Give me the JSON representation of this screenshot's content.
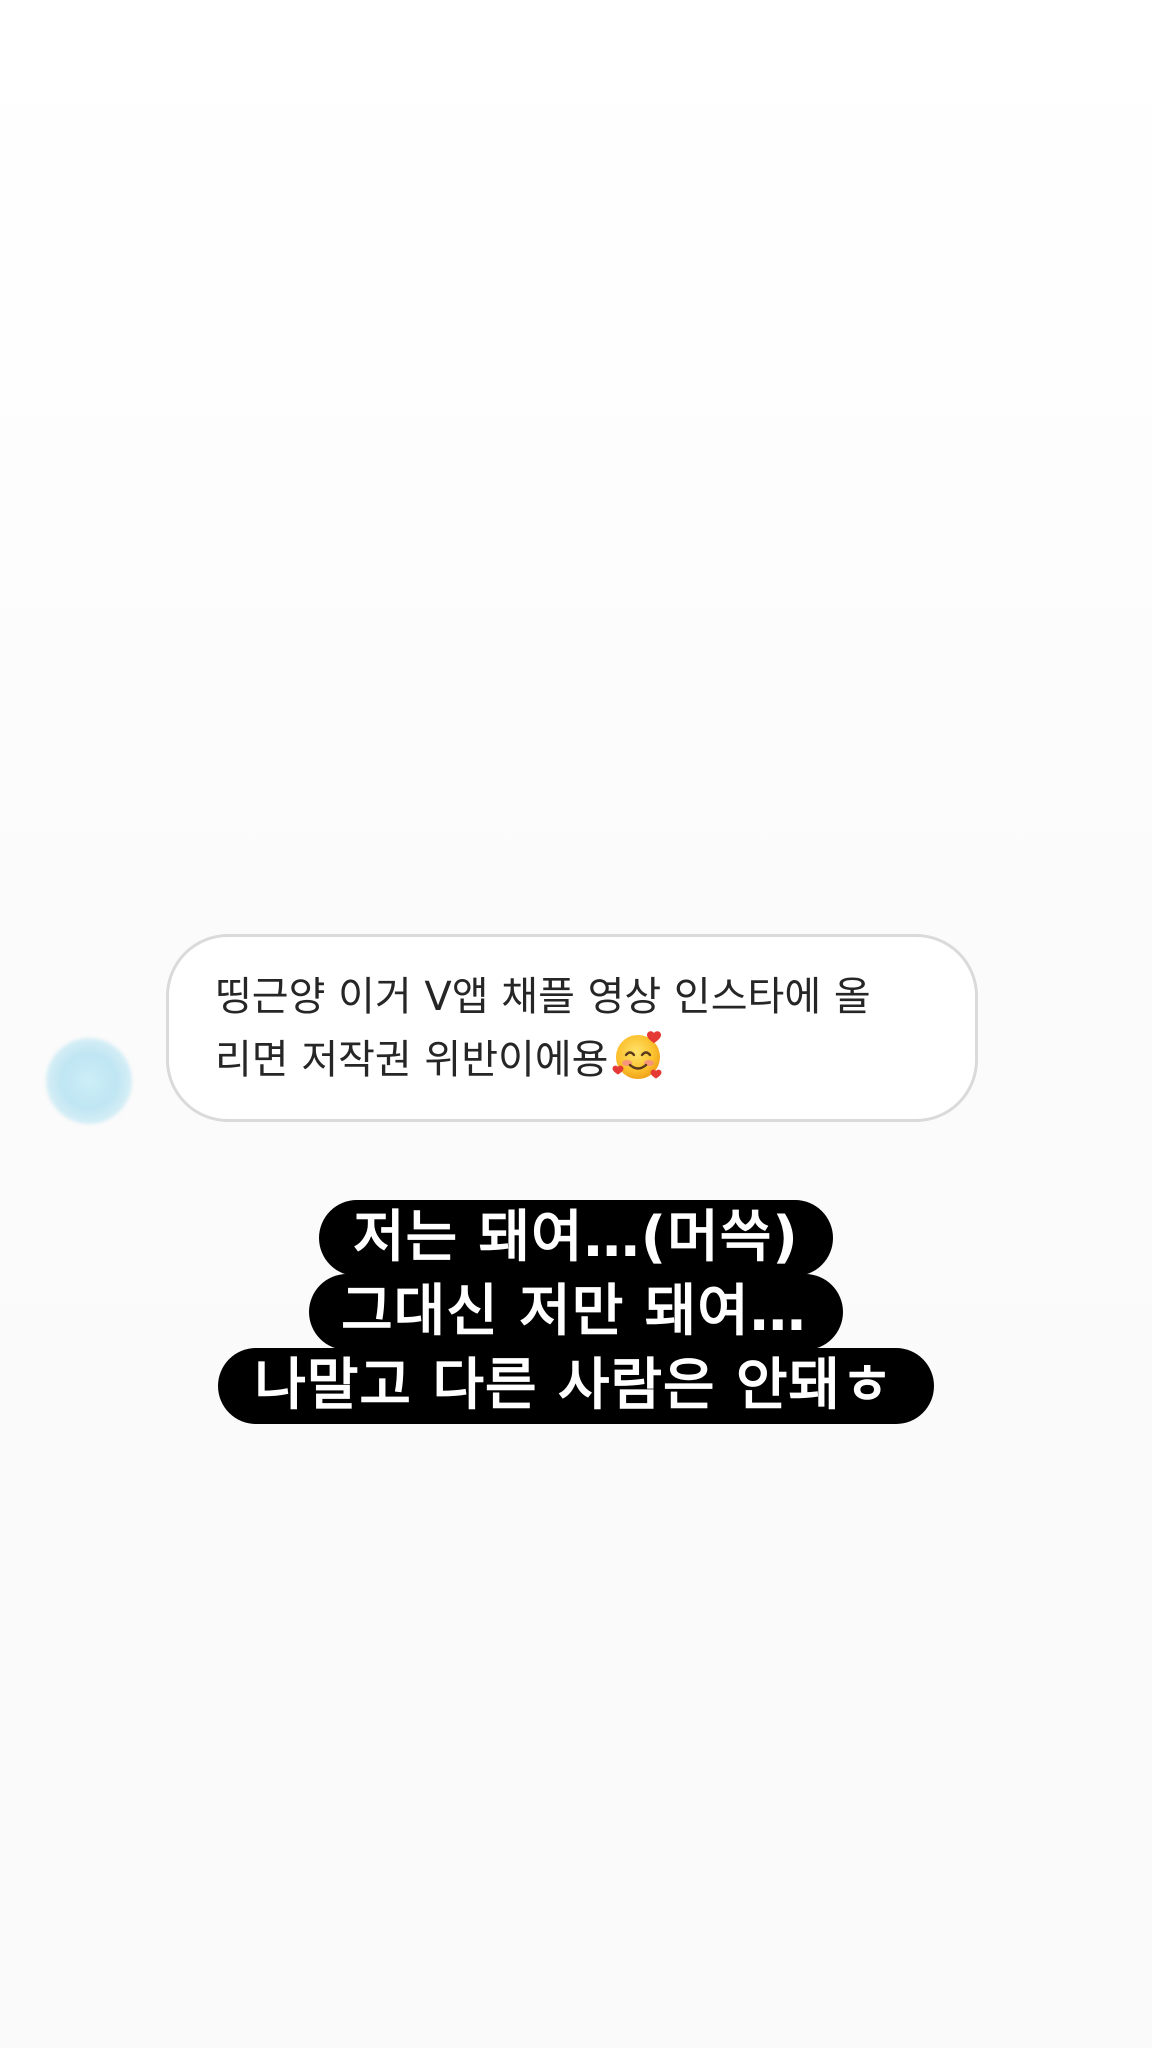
{
  "dm_reply": {
    "message_line_1": "띵근양 이거 V앱 채플 영상 인스타에 올",
    "message_line_2": "리면 저작권 위반이에용",
    "emoji_icon": "smiling-face-with-hearts-icon",
    "avatar_color": "#bfe6f3"
  },
  "caption": {
    "lines": [
      "저는 돼여…(머쓱)",
      "그대신 저만 돼여…",
      "나말고 다른 사람은 안돼ㅎ"
    ],
    "background_color": "#000000",
    "text_color": "#ffffff"
  }
}
